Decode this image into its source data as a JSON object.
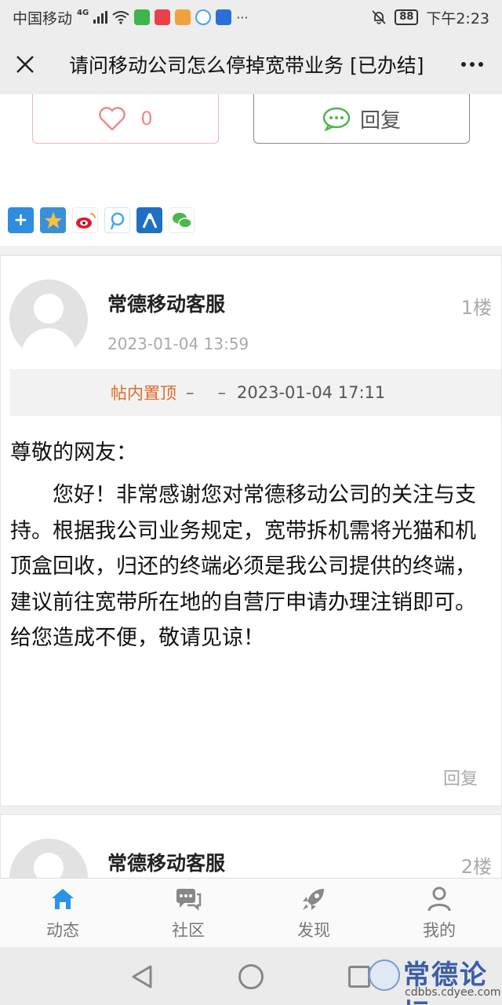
{
  "status_bar": {
    "carrier": "中国移动",
    "network": "4G",
    "battery": "88",
    "time": "下午2:23"
  },
  "header": {
    "title": "请问移动公司怎么停掉宽带业务 [已办结]"
  },
  "actions": {
    "like_count": "0",
    "reply_label": "回复"
  },
  "share_icons": [
    "plus-icon",
    "qzone-icon",
    "weibo-icon",
    "tencent-weibo-icon",
    "renren-icon",
    "wechat-icon"
  ],
  "posts": [
    {
      "author": "常德移动客服",
      "floor": "1楼",
      "time": "2023-01-04 13:59",
      "pin_label": "帖内置顶",
      "pin_dash1": "–",
      "pin_dash2": "–",
      "pin_time": "2023-01-04 17:11",
      "greeting": "尊敬的网友：",
      "body": "您好！非常感谢您对常德移动公司的关注与支持。根据我公司业务规定，宽带拆机需将光猫和机顶盒回收，归还的终端必须是我公司提供的终端，建议前往宽带所在地的自营厅申请办理注销即可。给您造成不便，敬请见谅！",
      "reply_label": "回复"
    },
    {
      "author": "常德移动客服",
      "floor": "2楼"
    }
  ],
  "bottom_nav": [
    {
      "label": "动态",
      "icon": "home-icon",
      "active": true
    },
    {
      "label": "社区",
      "icon": "chat-icon",
      "active": false
    },
    {
      "label": "发现",
      "icon": "rocket-icon",
      "active": false
    },
    {
      "label": "我的",
      "icon": "user-icon",
      "active": false
    }
  ],
  "watermark": {
    "title": "常德论坛",
    "url": "cdbbs.cdyee.com"
  },
  "colors": {
    "accent": "#2a93e8",
    "pin": "#e06a2a",
    "like": "#f08a8a"
  }
}
